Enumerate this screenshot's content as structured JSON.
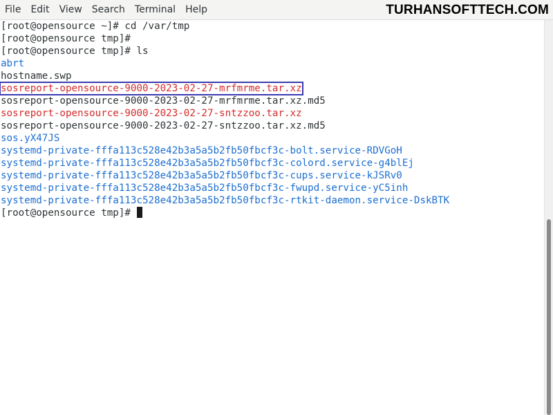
{
  "menu": {
    "items": [
      {
        "label": "File"
      },
      {
        "label": "Edit"
      },
      {
        "label": "View"
      },
      {
        "label": "Search"
      },
      {
        "label": "Terminal"
      },
      {
        "label": "Help"
      }
    ]
  },
  "watermark": "TURHANSOFTTECH.COM",
  "terminal": {
    "lines": [
      {
        "text": "[root@opensource ~]# cd /var/tmp",
        "kind": "prompt"
      },
      {
        "text": "[root@opensource tmp]#",
        "kind": "prompt"
      },
      {
        "text": "[root@opensource tmp]# ls",
        "kind": "prompt"
      },
      {
        "text": "abrt",
        "kind": "dir"
      },
      {
        "text": "hostname.swp",
        "kind": "file"
      },
      {
        "text": "sosreport-opensource-9000-2023-02-27-mrfmrme.tar.xz",
        "kind": "archive",
        "highlighted": true
      },
      {
        "text": "sosreport-opensource-9000-2023-02-27-mrfmrme.tar.xz.md5",
        "kind": "file"
      },
      {
        "text": "sosreport-opensource-9000-2023-02-27-sntzzoo.tar.xz",
        "kind": "archive"
      },
      {
        "text": "sosreport-opensource-9000-2023-02-27-sntzzoo.tar.xz.md5",
        "kind": "file"
      },
      {
        "text": "sos.yX47JS",
        "kind": "dir"
      },
      {
        "text": "systemd-private-fffa113c528e42b3a5a5b2fb50fbcf3c-bolt.service-RDVGoH",
        "kind": "dir"
      },
      {
        "text": "systemd-private-fffa113c528e42b3a5a5b2fb50fbcf3c-colord.service-g4blEj",
        "kind": "dir"
      },
      {
        "text": "systemd-private-fffa113c528e42b3a5a5b2fb50fbcf3c-cups.service-kJSRv0",
        "kind": "dir"
      },
      {
        "text": "systemd-private-fffa113c528e42b3a5a5b2fb50fbcf3c-fwupd.service-yC5inh",
        "kind": "dir"
      },
      {
        "text": "systemd-private-fffa113c528e42b3a5a5b2fb50fbcf3c-rtkit-daemon.service-DskBTK",
        "kind": "dir"
      },
      {
        "text": "[root@opensource tmp]# ",
        "kind": "prompt",
        "cursor": true
      }
    ],
    "colors": {
      "dir": "#1c6fd1",
      "archive": "#d42c2c",
      "text": "#2e3436",
      "highlight_border": "#3a3ab0"
    }
  }
}
